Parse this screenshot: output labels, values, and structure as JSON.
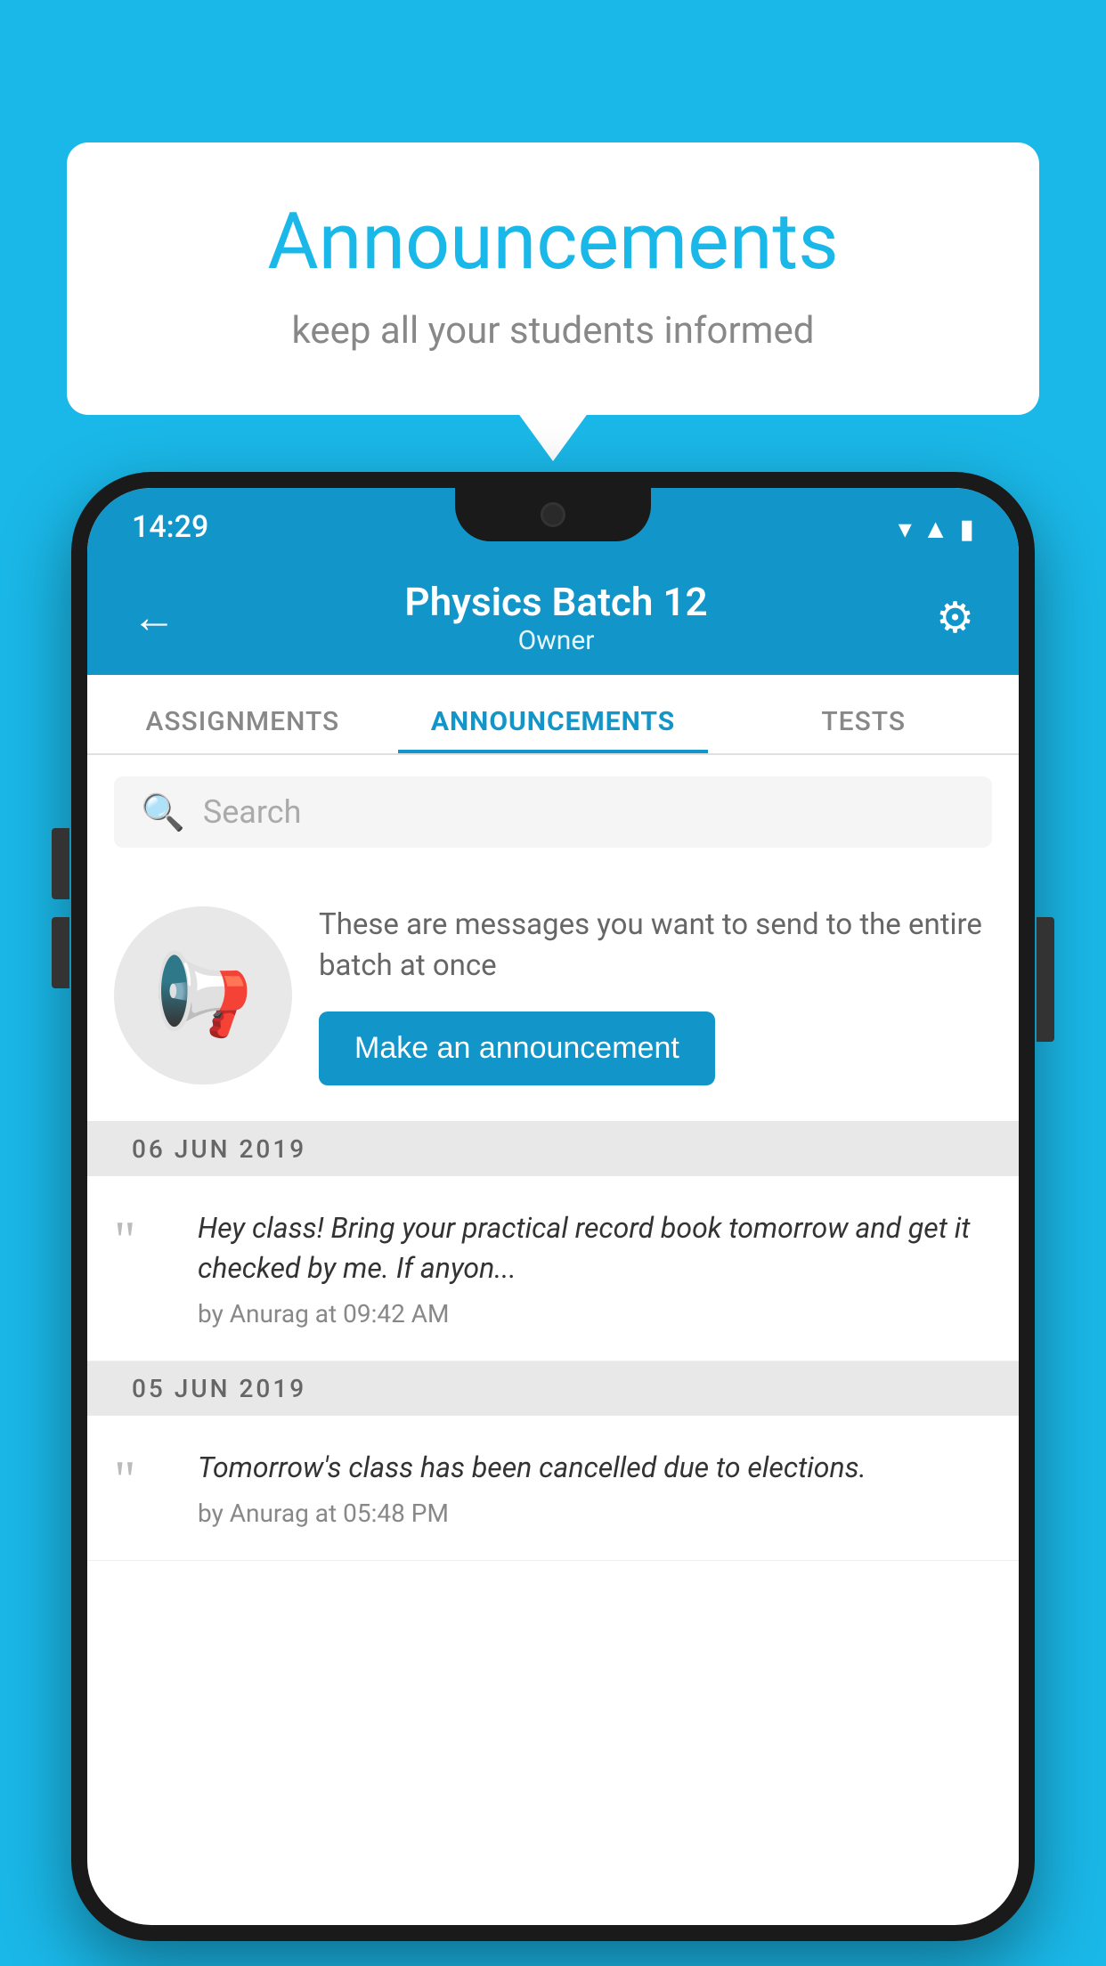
{
  "background": {
    "color": "#1ab8e8"
  },
  "speech_bubble": {
    "title": "Announcements",
    "subtitle": "keep all your students informed"
  },
  "phone": {
    "status_bar": {
      "time": "14:29"
    },
    "header": {
      "title": "Physics Batch 12",
      "subtitle": "Owner",
      "back_label": "←",
      "settings_label": "⚙"
    },
    "tabs": [
      {
        "label": "ASSIGNMENTS",
        "active": false
      },
      {
        "label": "ANNOUNCEMENTS",
        "active": true
      },
      {
        "label": "TESTS",
        "active": false
      }
    ],
    "search": {
      "placeholder": "Search"
    },
    "promo": {
      "description": "These are messages you want to send to the entire batch at once",
      "button_label": "Make an announcement"
    },
    "announcements": [
      {
        "date": "06  JUN  2019",
        "text": "Hey class! Bring your practical record book tomorrow and get it checked by me. If anyon...",
        "meta": "by Anurag at 09:42 AM"
      },
      {
        "date": "05  JUN  2019",
        "text": "Tomorrow's class has been cancelled due to elections.",
        "meta": "by Anurag at 05:48 PM"
      }
    ]
  }
}
